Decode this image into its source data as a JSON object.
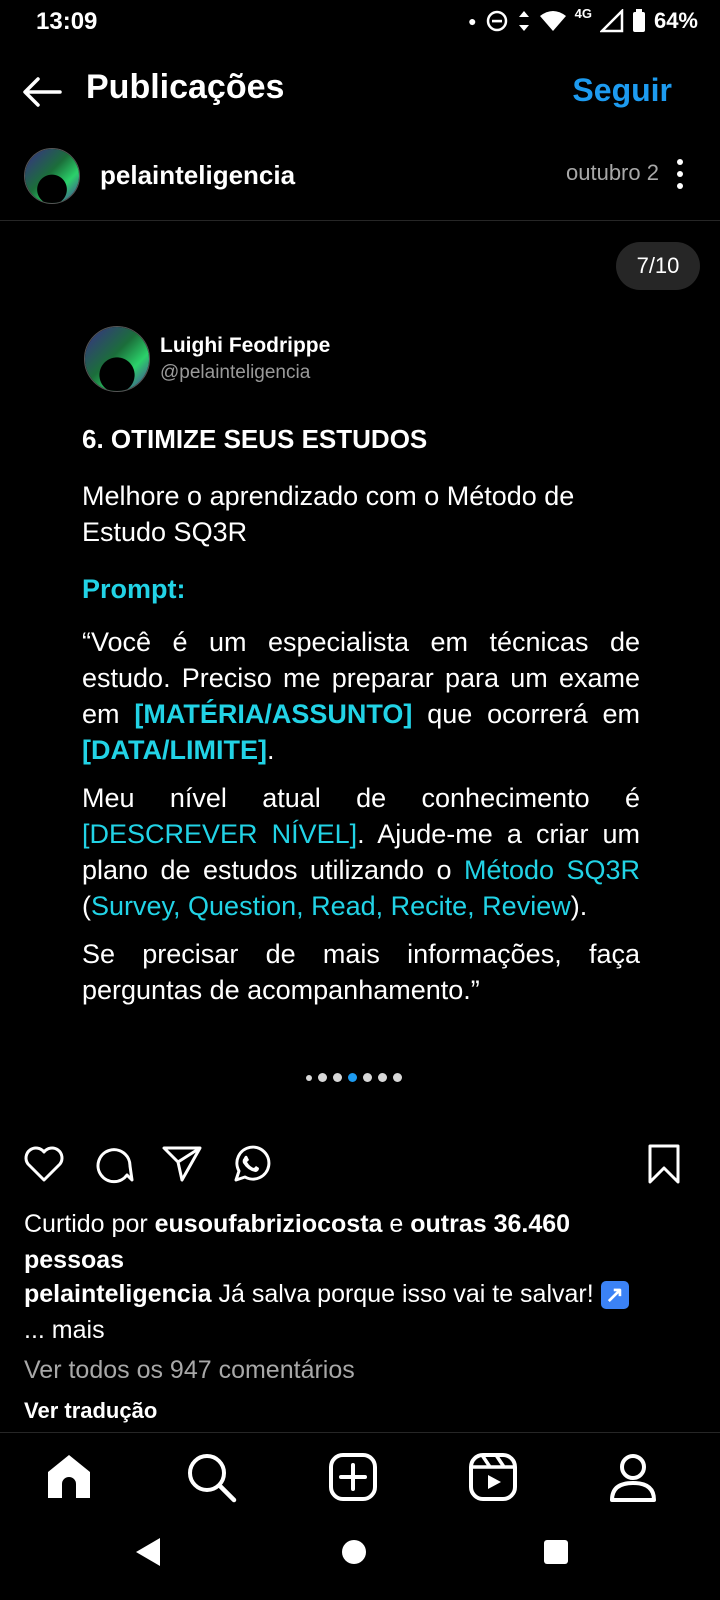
{
  "status": {
    "time": "13:09",
    "network": "4G",
    "battery": "64%"
  },
  "header": {
    "title": "Publicações",
    "follow": "Seguir"
  },
  "post": {
    "username": "pelainteligencia",
    "date": "outubro 2",
    "counter": "7/10"
  },
  "card": {
    "name": "Luighi Feodrippe",
    "handle": "@pelainteligencia",
    "heading": "6. OTIMIZE SEUS ESTUDOS",
    "intro": "Melhore o aprendizado com o Método de Estudo SQ3R",
    "prompt_label": "Prompt:",
    "p1": {
      "a": "“Você é um especialista em técnicas de estudo. Preciso me preparar para um exame em ",
      "b": "[MATÉRIA/ASSUNTO]",
      "c": " que ocorrerá em ",
      "d": "[DATA/LIMITE]",
      "e": "."
    },
    "p2": {
      "a": "Meu nível atual de conhecimento é ",
      "b": "[DESCREVER NÍVEL]",
      "c": ". Ajude-me a criar um plano de estudos utilizando o ",
      "d": "Método SQ3R",
      "e": " (",
      "f": "Survey, Question, Read, Recite, Review",
      "g": ")."
    },
    "p3": "Se precisar de mais informações, faça perguntas de acompanhamento.”"
  },
  "likes": {
    "prefix": "Curtido por ",
    "user": "eusoufabriziocosta",
    "middle": " e ",
    "others": "outras 36.460",
    "suffix": "pessoas"
  },
  "caption": {
    "user": "pelainteligencia",
    "text": " Já salva porque isso vai te salvar! ",
    "emoji": "↗",
    "more": "... mais"
  },
  "comments_link": "Ver todos os 947 comentários",
  "translate": "Ver tradução",
  "icons": {
    "actions": [
      "heart-icon",
      "comment-icon",
      "share-icon",
      "whatsapp-icon",
      "bookmark-icon"
    ],
    "nav": [
      "home-icon",
      "search-icon",
      "create-icon",
      "reels-icon",
      "profile-icon"
    ],
    "system": [
      "back-triangle-icon",
      "home-circle-icon",
      "recents-square-icon"
    ]
  },
  "colors": {
    "accent": "#1d9bf0",
    "highlight": "#22d3e6",
    "background": "#000000"
  }
}
